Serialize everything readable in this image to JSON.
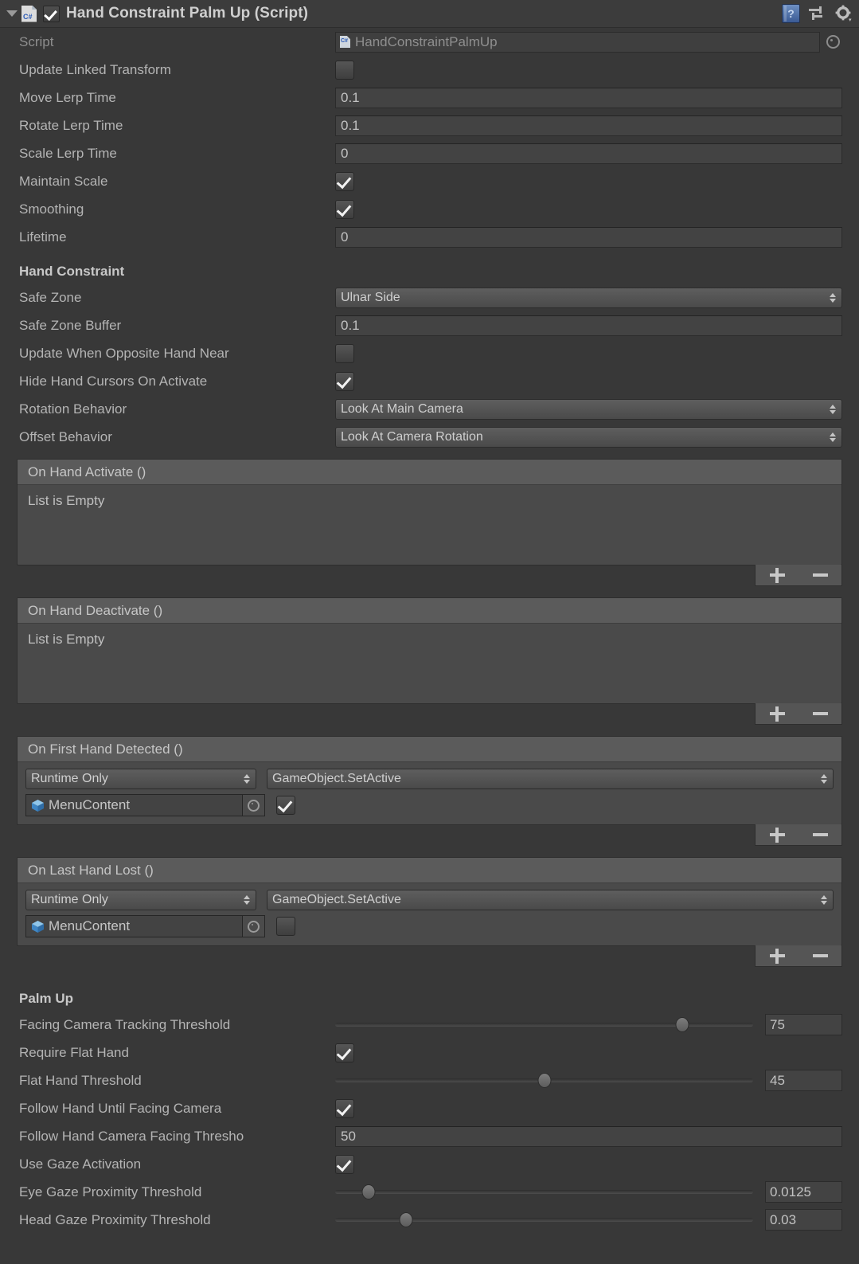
{
  "header": {
    "title": "Hand Constraint Palm Up (Script)",
    "enabled_checkbox": true,
    "script_icon": "csharp-script-icon",
    "foldout": "expanded",
    "help_icon": "help-book-icon",
    "preset_icon": "preset-sliders-icon",
    "gear_icon": "gear-icon"
  },
  "script_row": {
    "label": "Script",
    "value": "HandConstraintPalmUp"
  },
  "general_rows": [
    {
      "label": "Update Linked Transform",
      "type": "checkbox",
      "checked": false
    },
    {
      "label": "Move Lerp Time",
      "type": "text",
      "value": "0.1"
    },
    {
      "label": "Rotate Lerp Time",
      "type": "text",
      "value": "0.1"
    },
    {
      "label": "Scale Lerp Time",
      "type": "text",
      "value": "0"
    },
    {
      "label": "Maintain Scale",
      "type": "checkbox",
      "checked": true
    },
    {
      "label": "Smoothing",
      "type": "checkbox",
      "checked": true
    },
    {
      "label": "Lifetime",
      "type": "text",
      "value": "0"
    }
  ],
  "hand_constraint": {
    "section_title": "Hand Constraint",
    "rows": [
      {
        "label": "Safe Zone",
        "type": "dropdown",
        "value": "Ulnar Side"
      },
      {
        "label": "Safe Zone Buffer",
        "type": "text",
        "value": "0.1"
      },
      {
        "label": "Update When Opposite Hand Near",
        "type": "checkbox",
        "checked": false
      },
      {
        "label": "Hide Hand Cursors On Activate",
        "type": "checkbox",
        "checked": true
      },
      {
        "label": "Rotation Behavior",
        "type": "dropdown",
        "value": "Look At Main Camera"
      },
      {
        "label": "Offset Behavior",
        "type": "dropdown",
        "value": "Look At Camera Rotation"
      }
    ]
  },
  "events": [
    {
      "title": "On Hand Activate ()",
      "empty_text": "List is Empty",
      "entries": [],
      "add_label": "+",
      "remove_label": "–"
    },
    {
      "title": "On Hand Deactivate ()",
      "empty_text": "List is Empty",
      "entries": [],
      "add_label": "+",
      "remove_label": "–"
    },
    {
      "title": "On First Hand Detected ()",
      "empty_text": "",
      "entries": [
        {
          "mode": "Runtime Only",
          "function": "GameObject.SetActive",
          "object": "MenuContent",
          "object_icon": "gameobject-cube-icon",
          "arg_checked": true
        }
      ],
      "add_label": "+",
      "remove_label": "–"
    },
    {
      "title": "On Last Hand Lost ()",
      "empty_text": "",
      "entries": [
        {
          "mode": "Runtime Only",
          "function": "GameObject.SetActive",
          "object": "MenuContent",
          "object_icon": "gameobject-cube-icon",
          "arg_checked": false
        }
      ],
      "add_label": "+",
      "remove_label": "–"
    }
  ],
  "palm_up": {
    "section_title": "Palm Up",
    "rows": [
      {
        "label": "Facing Camera Tracking Threshold",
        "type": "slider",
        "value": "75",
        "percent": 83
      },
      {
        "label": "Require Flat Hand",
        "type": "checkbox",
        "checked": true
      },
      {
        "label": "Flat Hand Threshold",
        "type": "slider",
        "value": "45",
        "percent": 50
      },
      {
        "label": "Follow Hand Until Facing Camera",
        "type": "checkbox",
        "checked": true
      },
      {
        "label": "Follow Hand Camera Facing Thresho",
        "type": "text",
        "value": "50"
      },
      {
        "label": "Use Gaze Activation",
        "type": "checkbox",
        "checked": true
      },
      {
        "label": "Eye Gaze Proximity Threshold",
        "type": "slider",
        "value": "0.0125",
        "percent": 8
      },
      {
        "label": "Head Gaze Proximity Threshold",
        "type": "slider",
        "value": "0.03",
        "percent": 17
      }
    ]
  },
  "colors": {
    "background": "#383838",
    "header_bar": "#3c3c3c",
    "field": "#434343",
    "list_header": "#5b5b5b",
    "list_body": "#4a4a4a",
    "text": "#b4b4b4"
  }
}
